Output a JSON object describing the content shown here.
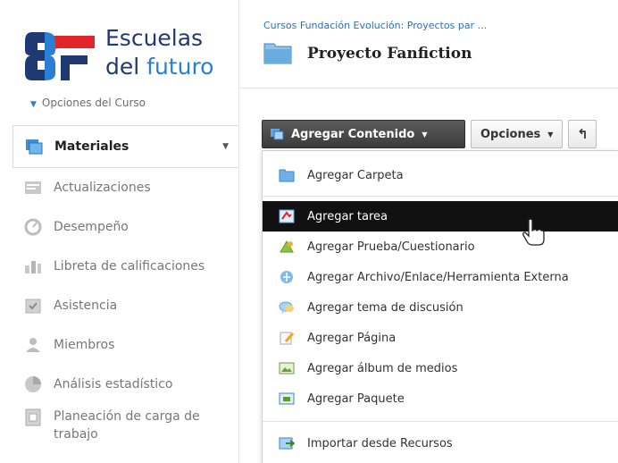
{
  "brand": {
    "line1": "Escuelas",
    "line2_a": "del",
    "line2_b": "futuro",
    "colors": {
      "navy": "#1f3a72",
      "blue": "#2a7fd4",
      "red": "#e0262b"
    }
  },
  "sidebar": {
    "course_options": "Opciones del Curso",
    "items": [
      {
        "label": "Materiales",
        "icon": "materials-icon",
        "active": true
      },
      {
        "label": "Actualizaciones",
        "icon": "updates-icon"
      },
      {
        "label": "Desempeño",
        "icon": "performance-icon"
      },
      {
        "label": "Libreta de calificaciones",
        "icon": "gradebook-icon"
      },
      {
        "label": "Asistencia",
        "icon": "attendance-icon"
      },
      {
        "label": "Miembros",
        "icon": "members-icon"
      },
      {
        "label": "Análisis estadístico",
        "icon": "statistics-icon"
      },
      {
        "label": "Planeación de carga de trabajo",
        "icon": "workload-icon"
      }
    ]
  },
  "header": {
    "breadcrumb": "Cursos Fundación Evolución: Proyectos par ...",
    "title": "Proyecto Fanfiction"
  },
  "toolbar": {
    "add_content": "Agregar Contenido",
    "options": "Opciones",
    "back": "↰"
  },
  "menu": {
    "items": [
      {
        "label": "Agregar Carpeta",
        "icon": "folder-icon"
      },
      {
        "label": "Agregar tarea",
        "icon": "assignment-icon",
        "highlighted": true
      },
      {
        "label": "Agregar Prueba/Cuestionario",
        "icon": "quiz-icon"
      },
      {
        "label": "Agregar Archivo/Enlace/Herramienta Externa",
        "icon": "file-link-icon"
      },
      {
        "label": "Agregar tema de discusión",
        "icon": "discussion-icon"
      },
      {
        "label": "Agregar Página",
        "icon": "page-icon"
      },
      {
        "label": "Agregar álbum de medios",
        "icon": "media-album-icon"
      },
      {
        "label": "Agregar Paquete",
        "icon": "package-icon"
      },
      {
        "label": "Importar desde Recursos",
        "icon": "import-icon"
      }
    ]
  }
}
